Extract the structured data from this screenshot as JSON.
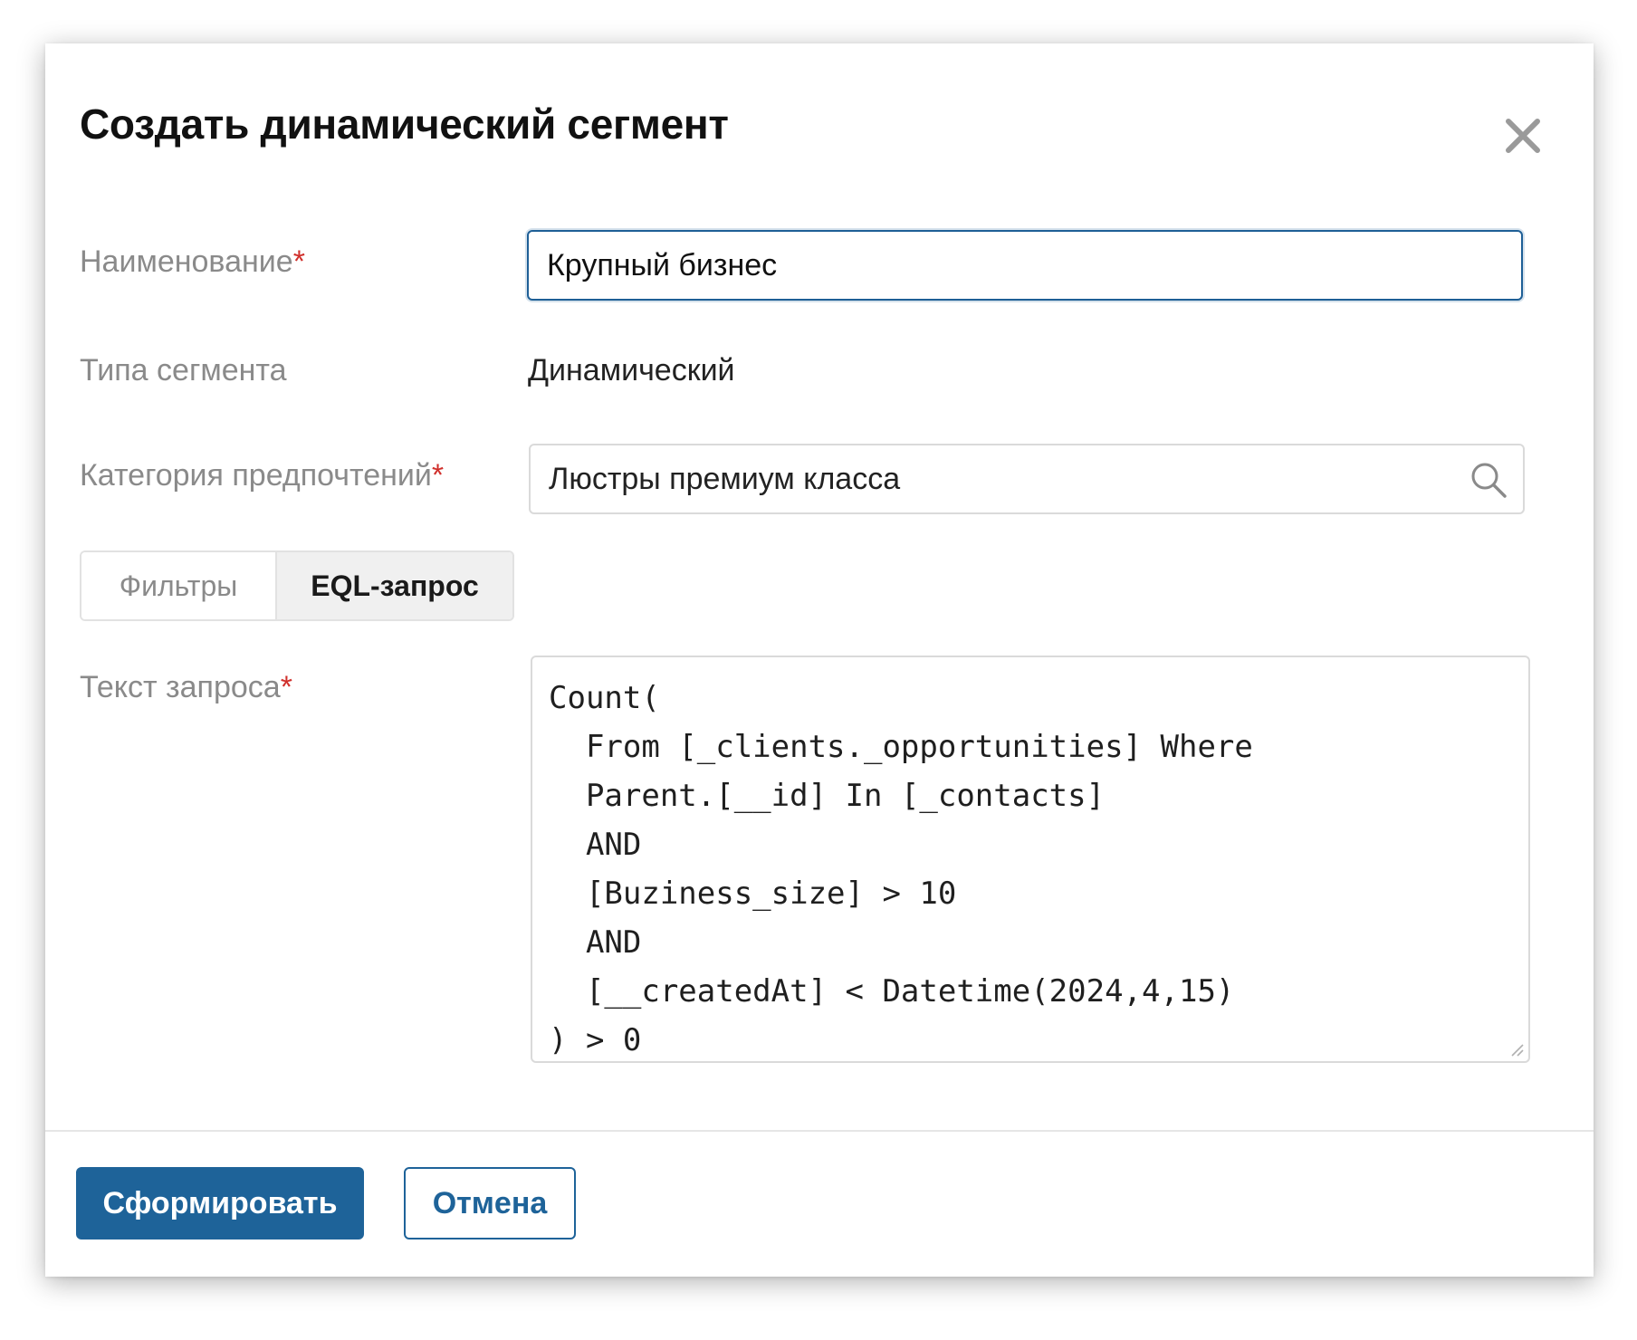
{
  "dialog": {
    "title": "Создать динамический сегмент"
  },
  "form": {
    "name": {
      "label": "Наименование",
      "required_mark": "*",
      "value": "Крупный бизнес"
    },
    "segment_type": {
      "label": "Типа сегмента",
      "value": "Динамический"
    },
    "category": {
      "label": "Категория предпочтений",
      "required_mark": "*",
      "value": "Люстры премиум класса",
      "icon": "search-icon"
    },
    "tabs": [
      {
        "label": "Фильтры",
        "active": false
      },
      {
        "label": "EQL-запрос",
        "active": true
      }
    ],
    "query": {
      "label": "Текст запроса",
      "required_mark": "*",
      "value": "Count(\n  From [_clients._opportunities] Where\n  Parent.[__id] In [_contacts]\n  AND\n  [Buziness_size] > 10\n  AND\n  [__createdAt] < Datetime(2024,4,15)\n) > 0"
    }
  },
  "footer": {
    "submit_label": "Сформировать",
    "cancel_label": "Отмена"
  },
  "colors": {
    "primary": "#1e6399",
    "required": "#d0302c",
    "label": "#8a8a8a"
  }
}
